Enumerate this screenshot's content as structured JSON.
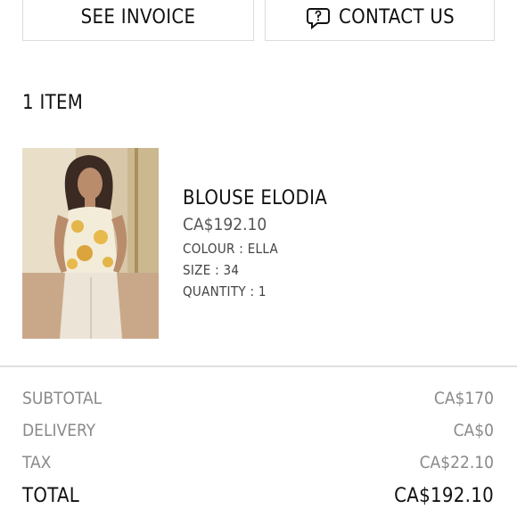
{
  "actions": {
    "see_invoice": "SEE INVOICE",
    "contact_us": "CONTACT US"
  },
  "order": {
    "items_title": "1 ITEM",
    "item": {
      "name": "BLOUSE ELODIA",
      "price": "CA$192.10",
      "colour": "COLOUR : ELLA",
      "size": "SIZE : 34",
      "quantity": "QUANTITY : 1"
    }
  },
  "summary": {
    "subtotal_label": "SUBTOTAL",
    "subtotal_value": "CA$170",
    "delivery_label": "DELIVERY",
    "delivery_value": "CA$0",
    "tax_label": "TAX",
    "tax_value": "CA$22.10",
    "total_label": "TOTAL",
    "total_value": "CA$192.10"
  },
  "icons": {
    "contact": "chat-question-icon"
  }
}
